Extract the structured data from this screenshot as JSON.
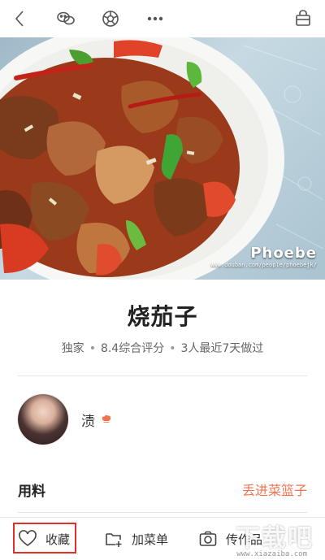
{
  "recipe": {
    "title": "烧茄子",
    "meta": {
      "tag": "独家",
      "score": "8.4综合评分",
      "cooked": "3人最近7天做过"
    },
    "photo_watermark": {
      "title": "Phoebe",
      "url": "www.douban.com/people/phoebejk/"
    }
  },
  "author": {
    "name": "渍"
  },
  "ingredients": {
    "heading": "用料",
    "basket_link": "丢进菜篮子"
  },
  "bottombar": {
    "favorite_label": "收藏",
    "add_menu_label": "加菜单",
    "upload_label": "传作品"
  },
  "site_watermark": {
    "text": "下载吧",
    "url": "www.xiazaiba.com"
  },
  "colors": {
    "accent": "#f2734f",
    "highlight_box": "#e0302c"
  }
}
